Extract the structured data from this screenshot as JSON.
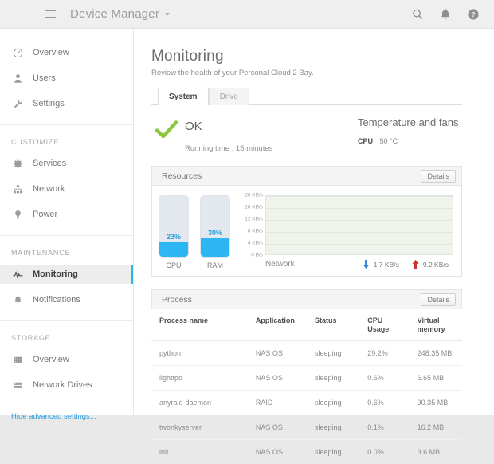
{
  "topbar": {
    "menu_icon": "hamburger-icon",
    "title": "Device Manager",
    "caret": "chevron-down-icon",
    "icons": [
      {
        "name": "search-icon"
      },
      {
        "name": "bell-icon"
      },
      {
        "name": "help-icon"
      }
    ]
  },
  "sidebar": {
    "items": [
      {
        "label": "Overview",
        "icon": "overview-icon",
        "active": false
      },
      {
        "label": "Users",
        "icon": "user-icon",
        "active": false
      },
      {
        "label": "Settings",
        "icon": "wrench-icon",
        "active": false
      }
    ],
    "groups": [
      {
        "title": "CUSTOMIZE",
        "items": [
          {
            "label": "Services",
            "icon": "gear-icon",
            "active": false
          },
          {
            "label": "Network",
            "icon": "network-icon",
            "active": false
          },
          {
            "label": "Power",
            "icon": "power-icon",
            "active": false
          }
        ]
      },
      {
        "title": "MAINTENANCE",
        "items": [
          {
            "label": "Monitoring",
            "icon": "pulse-icon",
            "active": true
          },
          {
            "label": "Notifications",
            "icon": "bell-icon",
            "active": false
          }
        ]
      },
      {
        "title": "STORAGE",
        "items": [
          {
            "label": "Overview",
            "icon": "drive-icon",
            "active": false
          },
          {
            "label": "Network Drives",
            "icon": "drive-icon",
            "active": false
          }
        ]
      }
    ],
    "advanced_link": "Hide advanced settings..."
  },
  "main": {
    "title": "Monitoring",
    "subtitle": "Review the health of your Personal Cloud 2 Bay.",
    "tabs": [
      {
        "label": "System",
        "active": true
      },
      {
        "label": "Drive",
        "active": false
      }
    ],
    "status": {
      "icon": "check-icon",
      "state": "OK",
      "running_time": "Running time : 15 minutes"
    },
    "temperature": {
      "title": "Temperature and fans",
      "label": "CPU",
      "value": "50 °C"
    },
    "resources": {
      "panel_title": "Resources",
      "details_label": "Details",
      "gauges": [
        {
          "name": "CPU",
          "percent_label": "23%",
          "percent": 23
        },
        {
          "name": "RAM",
          "percent_label": "30%",
          "percent": 30
        }
      ],
      "network": {
        "label": "Network",
        "download": "1.7 KB/s",
        "upload": "9.2 KB/s",
        "download_icon": "arrow-down-icon",
        "upload_icon": "arrow-up-icon"
      }
    },
    "process": {
      "panel_title": "Process",
      "details_label": "Details",
      "columns": [
        "Process name",
        "Application",
        "Status",
        "CPU Usage",
        "Virtual memory"
      ],
      "rows": [
        {
          "name": "python",
          "app": "NAS OS",
          "status": "sleeping",
          "cpu": "29.2%",
          "mem": "248.35 MB"
        },
        {
          "name": "lighttpd",
          "app": "NAS OS",
          "status": "sleeping",
          "cpu": "0.6%",
          "mem": "6.65 MB"
        },
        {
          "name": "anyraid-daemon",
          "app": "RAID",
          "status": "sleeping",
          "cpu": "0.6%",
          "mem": "90.35 MB"
        },
        {
          "name": "twonkyserver",
          "app": "NAS OS",
          "status": "sleeping",
          "cpu": "0.1%",
          "mem": "16.2 MB"
        },
        {
          "name": "init",
          "app": "NAS OS",
          "status": "sleeping",
          "cpu": "0.0%",
          "mem": "3.6 MB"
        }
      ]
    }
  },
  "chart_data": {
    "type": "line",
    "title": "Network",
    "xlabel": "",
    "ylabel": "KB/s",
    "ylim": [
      0,
      20
    ],
    "yticks": [
      "20 KB/s",
      "16 KB/s",
      "12 KB/s",
      "8 KB/s",
      "4 KB/s",
      "0 B/s"
    ],
    "ytick_values": [
      20,
      16,
      12,
      8,
      4,
      0
    ],
    "grid": true,
    "legend_position": "bottom-right",
    "series": [
      {
        "name": "download",
        "current": 1.7,
        "unit": "KB/s",
        "color": "#2f86d8",
        "values": []
      },
      {
        "name": "upload",
        "current": 9.2,
        "unit": "KB/s",
        "color": "#d03030",
        "values": []
      }
    ],
    "plot_background": "#eef4ec"
  },
  "colors": {
    "accent": "#29b6e8",
    "gauge_fill": "#2cb6f4",
    "ok_green": "#8cc63f",
    "link": "#2f9fe0",
    "download": "#2f86d8",
    "upload": "#d03030"
  }
}
